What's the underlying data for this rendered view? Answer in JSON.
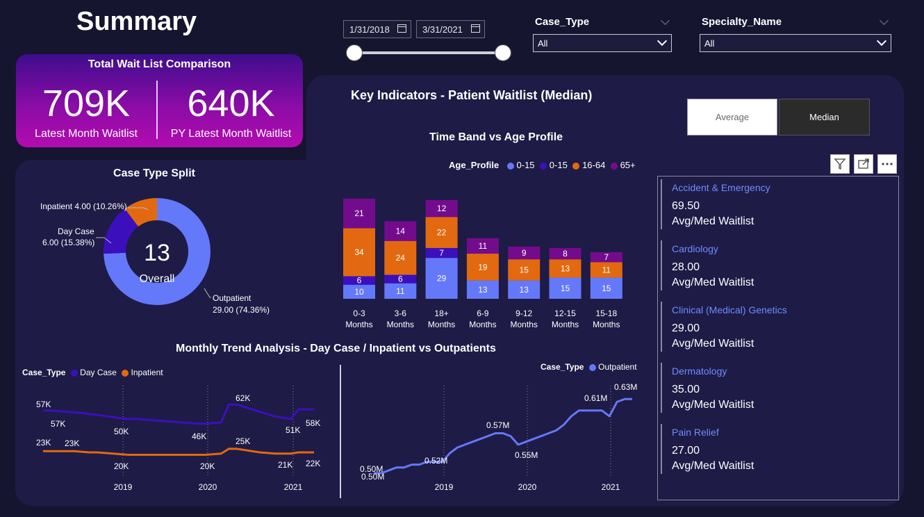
{
  "page_title": "Summary",
  "date_range": {
    "start": "1/31/2018",
    "end": "3/31/2021"
  },
  "slicers": [
    {
      "label": "Case_Type",
      "value": "All"
    },
    {
      "label": "Specialty_Name",
      "value": "All"
    }
  ],
  "kpi": {
    "title": "Total Wait List Comparison",
    "latest_value": "709K",
    "latest_label": "Latest Month Waitlist",
    "py_value": "640K",
    "py_label": "PY Latest Month Waitlist"
  },
  "key_indicators_title": "Key Indicators - Patient Waitlist (Median)",
  "toggle": {
    "average": "Average",
    "median": "Median"
  },
  "colors": {
    "outpatient": "#6478fa",
    "day_case": "#3c0fbd",
    "inpatient": "#e2690f",
    "age_65": "#730c8c",
    "bg": "#161530",
    "panel": "#1e1b46"
  },
  "icons": [
    "calendar-icon",
    "filter-icon",
    "expand-icon",
    "more-options-icon",
    "chevron-down-icon"
  ],
  "specialties": [
    {
      "name": "Accident & Emergency",
      "value": "69.50",
      "sub": "Avg/Med Waitlist"
    },
    {
      "name": "Cardiology",
      "value": "28.00",
      "sub": "Avg/Med Waitlist"
    },
    {
      "name": "Clinical (Medical) Genetics",
      "value": "29.00",
      "sub": "Avg/Med Waitlist"
    },
    {
      "name": "Dermatology",
      "value": "35.00",
      "sub": "Avg/Med Waitlist"
    },
    {
      "name": "Pain Relief",
      "value": "27.00",
      "sub": "Avg/Med Waitlist"
    }
  ],
  "chart_data": [
    {
      "type": "pie",
      "title": "Case Type Split",
      "center_value": "13",
      "center_label": "Overall",
      "slices": [
        {
          "name": "Outpatient",
          "value": 29.0,
          "label": "Outpatient",
          "pct_label": "29.00 (74.36%)"
        },
        {
          "name": "Day Case",
          "value": 6.0,
          "label": "Day Case",
          "pct_label": "6.00 (15.38%)"
        },
        {
          "name": "Inpatient",
          "value": 4.0,
          "label": "Inpatient 4.00 (10.26%)"
        }
      ]
    },
    {
      "type": "bar",
      "title": "Time Band vs Age Profile",
      "legend_title": "Age_Profile",
      "categories": [
        "0-3 Months",
        "3-6 Months",
        "18+ Months",
        "6-9 Months",
        "9-12 Months",
        "12-15 Months",
        "15-18 Months"
      ],
      "series": [
        {
          "name": "0-15",
          "values": [
            10,
            11,
            29,
            13,
            13,
            15,
            15
          ]
        },
        {
          "name": "0-15",
          "values": [
            6,
            6,
            7,
            0,
            0,
            0,
            0
          ]
        },
        {
          "name": "16-64",
          "values": [
            34,
            24,
            22,
            19,
            15,
            13,
            11
          ]
        },
        {
          "name": "65+",
          "values": [
            21,
            14,
            12,
            11,
            9,
            8,
            7
          ]
        }
      ]
    },
    {
      "type": "line",
      "title": "Monthly Trend Analysis - Day Case / Inpatient vs Outpatients",
      "legend_title": "Case_Type",
      "x_ticks": [
        "2019",
        "2020",
        "2021"
      ],
      "series": [
        {
          "name": "Day Case",
          "values": [
            57,
            57,
            56.5,
            56,
            55.5,
            55,
            54,
            53.5,
            52.5,
            51.5,
            50.5,
            50,
            50,
            49.5,
            49,
            48.5,
            48,
            47.5,
            47,
            46.5,
            46,
            46,
            46.5,
            47,
            62,
            62,
            60,
            58,
            56,
            54,
            52,
            51,
            50,
            58,
            58,
            58
          ],
          "labels": [
            "57K",
            "57K",
            "50K",
            "46K",
            "62K",
            "51K",
            "58K"
          ]
        },
        {
          "name": "Inpatient",
          "values": [
            23,
            23,
            23,
            23,
            23,
            22.5,
            22,
            22,
            21.5,
            21,
            20.5,
            20,
            20,
            20,
            20,
            20,
            20,
            20,
            20,
            20,
            20,
            20,
            20.5,
            21,
            25,
            25,
            24,
            23,
            22,
            21.5,
            21,
            21,
            21,
            22,
            22,
            22
          ],
          "labels": [
            "23K",
            "23K",
            "20K",
            "20K",
            "25K",
            "21K",
            "22K"
          ]
        }
      ]
    },
    {
      "type": "line",
      "legend_title": "Case_Type",
      "x_ticks": [
        "2019",
        "2020",
        "2021"
      ],
      "series": [
        {
          "name": "Outpatient",
          "values": [
            0.5,
            0.5,
            0.505,
            0.51,
            0.51,
            0.515,
            0.515,
            0.52,
            0.52,
            0.52,
            0.535,
            0.545,
            0.55,
            0.555,
            0.56,
            0.565,
            0.57,
            0.57,
            0.565,
            0.55,
            0.555,
            0.56,
            0.565,
            0.57,
            0.575,
            0.585,
            0.6,
            0.61,
            0.61,
            0.61,
            0.61,
            0.6,
            0.625,
            0.63,
            0.63
          ],
          "labels": [
            "0.50M",
            "0.50M",
            "0.52M",
            "0.57M",
            "0.55M",
            "0.61M",
            "0.63M"
          ]
        }
      ]
    }
  ]
}
